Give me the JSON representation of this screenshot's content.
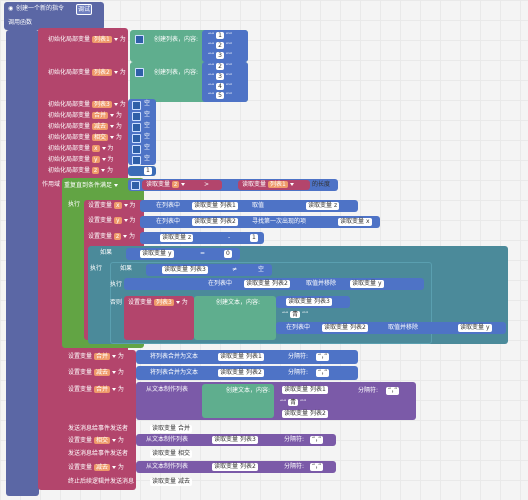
{
  "event": {
    "title": "创建一个新的指令",
    "tag": "调试",
    "call": "调用函数"
  },
  "locals": {
    "init_label": "初始化局部变量",
    "as": "为",
    "vars": [
      "列表1",
      "列表2",
      "列表3",
      "合并",
      "减去",
      "相交",
      "x",
      "y",
      "z"
    ],
    "empty": "空",
    "one": "1",
    "create_list": "创建列表，内容:",
    "list1_items": [
      "1",
      "2",
      "3"
    ],
    "list2_items": [
      "2",
      "3",
      "4",
      "5"
    ]
  },
  "scope": "作用域",
  "loop": {
    "repeat_while": "重复直到条件满足",
    "read_var": "读取变量",
    "op_gt": ">",
    "list_len": "的长度",
    "do": "执行"
  },
  "loop_body": {
    "set_var": "设置变量",
    "in_list": "在列表中",
    "get": "取值",
    "index": "索引",
    "find_first": "寻找第一次出现的项",
    "minus": "-",
    "add": "+",
    "if": "如果",
    "eq": "=",
    "ne": "≠",
    "remove": "取值并移除",
    "else": "否则",
    "create_text": "创建文本，内容:",
    "in_list_insert": "在列表中",
    "insert_at": "取值并移除",
    "hash": "#"
  },
  "after": {
    "list_to_text": "将列表合并为文本",
    "separator": "分隔符:",
    "sep_val": "“，”",
    "text_to_list": "从文本制作列表",
    "send_msg": "发送消息给事件发送者",
    "stop": "终止后续逻辑并发送消息"
  }
}
